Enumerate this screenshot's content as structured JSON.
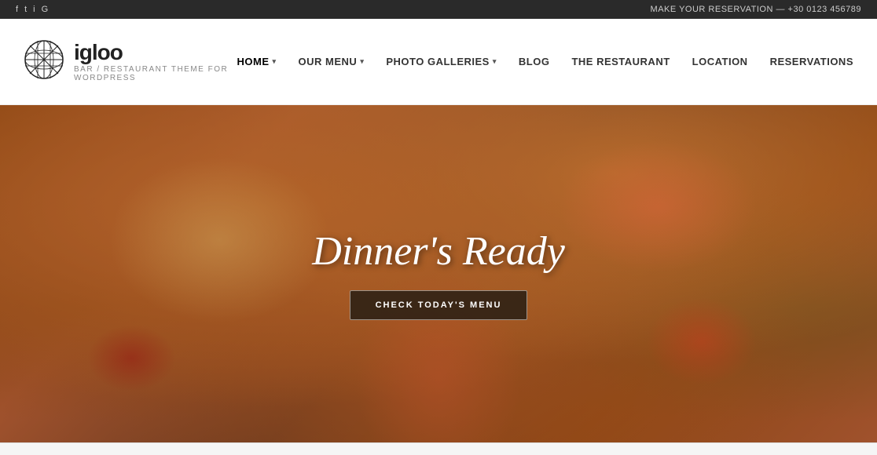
{
  "topbar": {
    "social_icons": [
      "f",
      "t",
      "i",
      "g"
    ],
    "phone_label": "MAKE YOUR RESERVATION",
    "phone_number": "+30 0123 456789",
    "phone_text": "MAKE YOUR RESERVATION — +30 0123 456789"
  },
  "header": {
    "logo_name": "igloo",
    "logo_tagline": "BAR / RESTAURANT THEME FOR WORDPRESS"
  },
  "nav": {
    "items": [
      {
        "label": "HOME",
        "has_dropdown": true
      },
      {
        "label": "OUR MENU",
        "has_dropdown": true
      },
      {
        "label": "PHOTO GALLERIES",
        "has_dropdown": true
      },
      {
        "label": "BLOG",
        "has_dropdown": false
      },
      {
        "label": "THE RESTAURANT",
        "has_dropdown": false
      },
      {
        "label": "LOCATION",
        "has_dropdown": false
      },
      {
        "label": "RESERVATIONS",
        "has_dropdown": false
      }
    ]
  },
  "hero": {
    "title": "Dinner's Ready",
    "button_label": "CHECK TODAY'S MENU"
  }
}
